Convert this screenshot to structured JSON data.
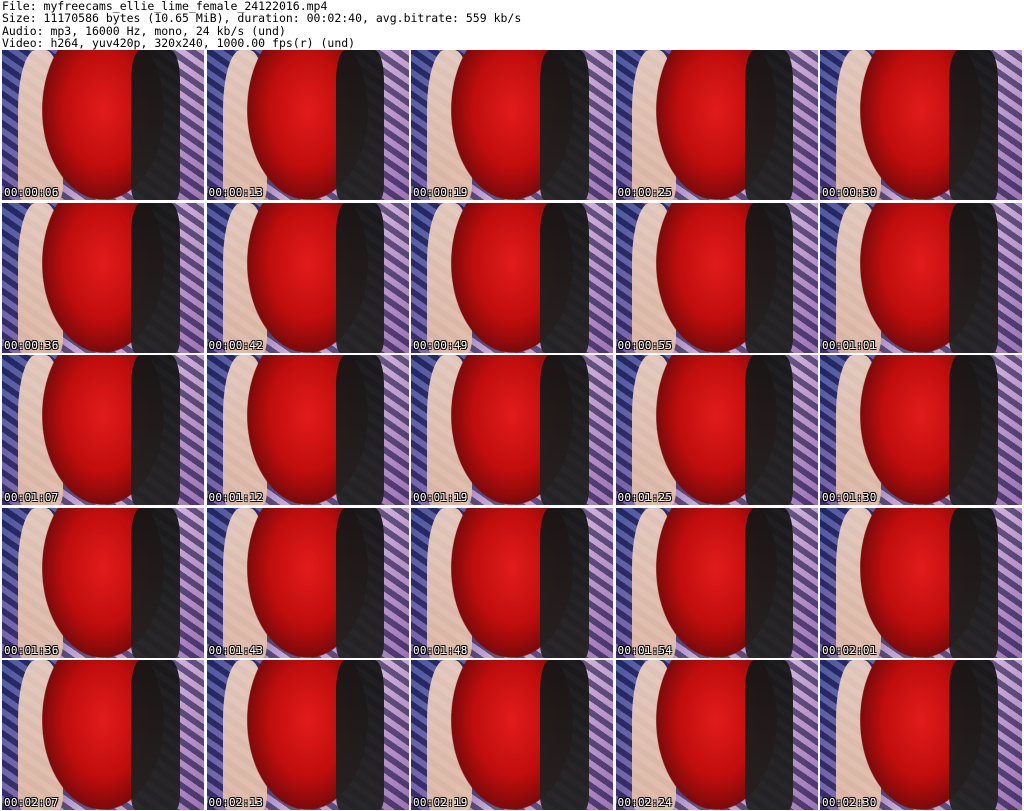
{
  "header": {
    "line1": "File: myfreecams_ellie_lime_female_24122016.mp4",
    "line2": "Size: 11170586 bytes (10.65 MiB), duration: 00:02:40, avg.bitrate: 559 kb/s",
    "line3": "Audio: mp3, 16000 Hz, mono, 24 kb/s (und)",
    "line4": "Video: h264, yuv420p, 320x240, 1000.00 fps(r) (und)"
  },
  "thumbnails": [
    {
      "time": "00:00:06"
    },
    {
      "time": "00:00:13"
    },
    {
      "time": "00:00:19"
    },
    {
      "time": "00:00:25"
    },
    {
      "time": "00:00:30"
    },
    {
      "time": "00:00:36"
    },
    {
      "time": "00:00:42"
    },
    {
      "time": "00:00:49"
    },
    {
      "time": "00:00:55"
    },
    {
      "time": "00:01:01"
    },
    {
      "time": "00:01:07"
    },
    {
      "time": "00:01:12"
    },
    {
      "time": "00:01:19"
    },
    {
      "time": "00:01:25"
    },
    {
      "time": "00:01:30"
    },
    {
      "time": "00:01:36"
    },
    {
      "time": "00:01:43"
    },
    {
      "time": "00:01:48"
    },
    {
      "time": "00:01:54"
    },
    {
      "time": "00:02:01"
    },
    {
      "time": "00:02:07"
    },
    {
      "time": "00:02:13"
    },
    {
      "time": "00:02:19"
    },
    {
      "time": "00:02:24"
    },
    {
      "time": "00:02:30"
    }
  ],
  "colors": {
    "background": "#ffffff",
    "dress": "#d11414",
    "timestamp_text": "#ffffff"
  }
}
